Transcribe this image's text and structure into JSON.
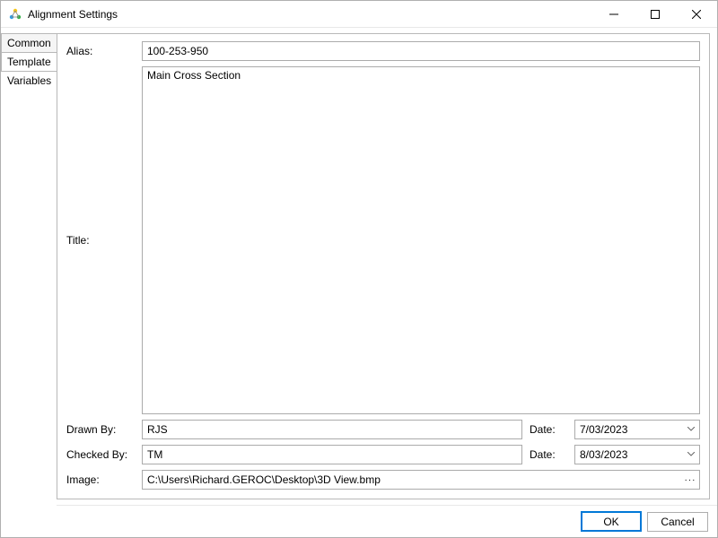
{
  "window": {
    "title": "Alignment Settings"
  },
  "tabs": {
    "common": "Common",
    "template": "Template",
    "variables": "Variables"
  },
  "labels": {
    "alias": "Alias:",
    "title": "Title:",
    "drawn_by": "Drawn By:",
    "checked_by": "Checked By:",
    "date": "Date:",
    "image": "Image:"
  },
  "fields": {
    "alias": "100-253-950",
    "title": "Main Cross Section",
    "drawn_by": "RJS",
    "drawn_date": "7/03/2023",
    "checked_by": "TM",
    "checked_date": "8/03/2023",
    "image": "C:\\Users\\Richard.GEROC\\Desktop\\3D View.bmp"
  },
  "buttons": {
    "ok": "OK",
    "cancel": "Cancel",
    "browse": "···"
  }
}
